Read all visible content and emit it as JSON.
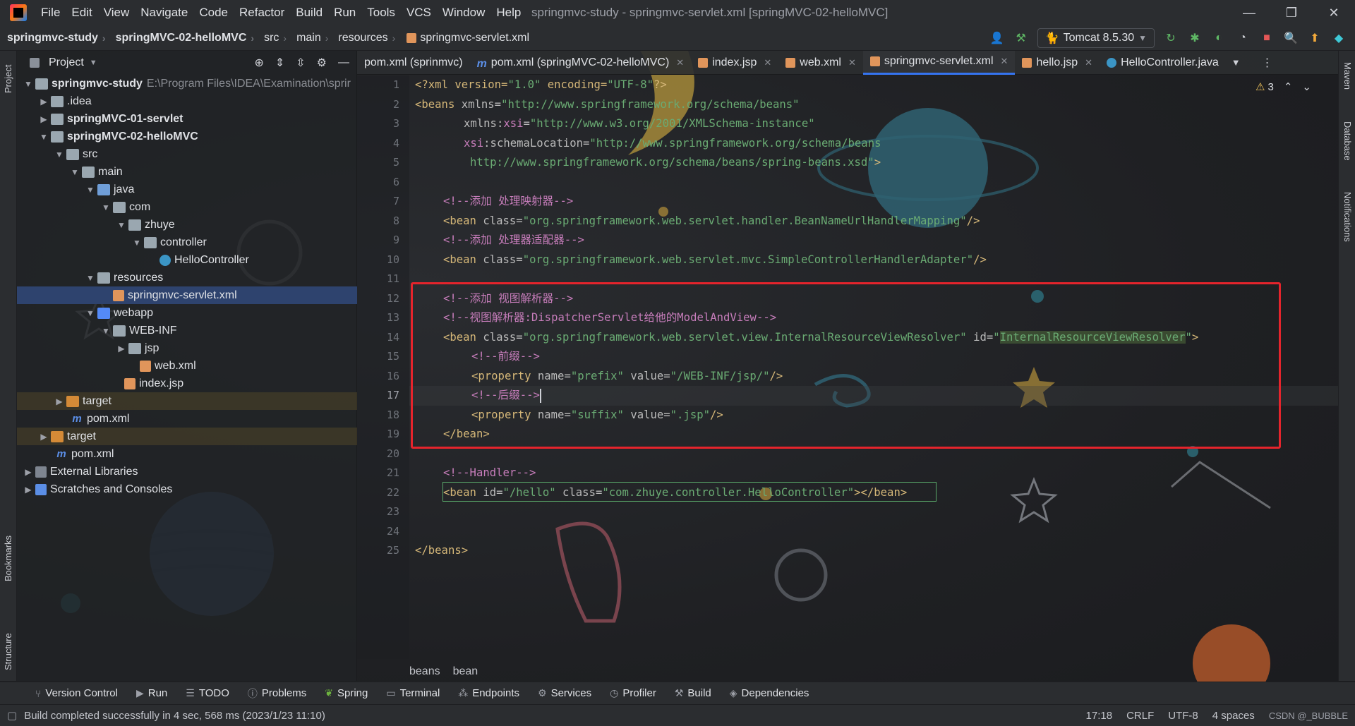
{
  "menubar": {
    "items": [
      "File",
      "Edit",
      "View",
      "Navigate",
      "Code",
      "Refactor",
      "Build",
      "Run",
      "Tools",
      "VCS",
      "Window",
      "Help"
    ],
    "title": "springmvc-study - springmvc-servlet.xml [springMVC-02-helloMVC]",
    "minimize": "—",
    "maximize": "❐",
    "close": "✕"
  },
  "navbar": {
    "crumbs": [
      "springmvc-study",
      "springMVC-02-helloMVC",
      "src",
      "main",
      "resources",
      "springmvc-servlet.xml"
    ],
    "run_config": "Tomcat 8.5.30"
  },
  "left_strip": {
    "project": "Project",
    "bookmarks": "Bookmarks",
    "structure": "Structure"
  },
  "right_strip": {
    "maven": "Maven",
    "database": "Database",
    "notifications": "Notifications"
  },
  "project_panel": {
    "title": "Project",
    "tree": [
      {
        "label": "springmvc-study",
        "path": "E:\\Program Files\\IDEA\\Examination\\sprir",
        "bold": true
      },
      {
        "label": ".idea"
      },
      {
        "label": "springMVC-01-servlet",
        "bold": true
      },
      {
        "label": "springMVC-02-helloMVC",
        "bold": true
      },
      {
        "label": "src"
      },
      {
        "label": "main"
      },
      {
        "label": "java"
      },
      {
        "label": "com"
      },
      {
        "label": "zhuye"
      },
      {
        "label": "controller"
      },
      {
        "label": "HelloController"
      },
      {
        "label": "resources"
      },
      {
        "label": "springmvc-servlet.xml"
      },
      {
        "label": "webapp"
      },
      {
        "label": "WEB-INF"
      },
      {
        "label": "jsp"
      },
      {
        "label": "web.xml"
      },
      {
        "label": "index.jsp"
      },
      {
        "label": "target"
      },
      {
        "label": "pom.xml"
      },
      {
        "label": "target"
      },
      {
        "label": "pom.xml"
      },
      {
        "label": "External Libraries"
      },
      {
        "label": "Scratches and Consoles"
      }
    ]
  },
  "tabs": [
    {
      "label": "pom.xml (sprinmvc)"
    },
    {
      "label": "pom.xml (springMVC-02-helloMVC)"
    },
    {
      "label": "index.jsp"
    },
    {
      "label": "web.xml"
    },
    {
      "label": "springmvc-servlet.xml"
    },
    {
      "label": "hello.jsp"
    },
    {
      "label": "HelloController.java"
    }
  ],
  "editor": {
    "warnings": "3",
    "line_numbers": [
      "1",
      "2",
      "3",
      "4",
      "5",
      "6",
      "7",
      "8",
      "9",
      "10",
      "11",
      "12",
      "13",
      "14",
      "15",
      "16",
      "17",
      "18",
      "19",
      "20",
      "21",
      "22",
      "23",
      "24",
      "25"
    ],
    "code": {
      "l1": [
        "<?xml version=",
        "\"1.0\"",
        " encoding=",
        "\"UTF-8\"",
        "?>"
      ],
      "l2": [
        "<beans ",
        "xmlns=",
        "\"http://www.springframework.org/schema/beans\""
      ],
      "l3": [
        "xmlns:",
        "xsi",
        "=",
        "\"http://www.w3.org/2001/XMLSchema-instance\""
      ],
      "l4": [
        "xsi",
        ":schemaLocation=",
        "\"http://www.springframework.org/schema/beans"
      ],
      "l5": [
        "http://www.springframework.org/schema/beans/spring-beans.xsd\"",
        ">"
      ],
      "l7": "<!--添加 处理映射器-->",
      "l8": [
        "<bean ",
        "class=",
        "\"org.springframework.web.servlet.handler.BeanNameUrlHandlerMapping\"",
        "/>"
      ],
      "l9": "<!--添加 处理器适配器-->",
      "l10": [
        "<bean ",
        "class=",
        "\"org.springframework.web.servlet.mvc.SimpleControllerHandlerAdapter\"",
        "/>"
      ],
      "l12": "<!--添加 视图解析器-->",
      "l13": "<!--视图解析器:DispatcherServlet给他的ModelAndView-->",
      "l14": [
        "<bean ",
        "class=",
        "\"org.springframework.web.servlet.view.InternalResourceViewResolver\"",
        " id=",
        "\"",
        "InternalResourceViewResolver",
        "\"",
        ">"
      ],
      "l15": "<!--前缀-->",
      "l16": [
        "<property ",
        "name=",
        "\"prefix\"",
        " value=",
        "\"/WEB-INF/jsp/\"",
        "/>"
      ],
      "l17": "<!--后缀-->",
      "l18": [
        "<property ",
        "name=",
        "\"suffix\"",
        " value=",
        "\".jsp\"",
        "/>"
      ],
      "l19": "</bean>",
      "l21": "<!--Handler-->",
      "l22": [
        "<bean ",
        "id=",
        "\"/hello\"",
        " class=",
        "\"com.zhuye.controller.HelloController\"",
        "></bean>"
      ],
      "l25": "</beans>"
    },
    "crumbs": [
      "beans",
      "bean"
    ]
  },
  "toolwindows": [
    "Version Control",
    "Run",
    "TODO",
    "Problems",
    "Spring",
    "Terminal",
    "Endpoints",
    "Services",
    "Profiler",
    "Build",
    "Dependencies"
  ],
  "statusbar": {
    "message": "Build completed successfully in 4 sec, 568 ms (2023/1/23 11:10)",
    "position": "17:18",
    "line_sep": "CRLF",
    "encoding": "UTF-8",
    "indent": "4 spaces",
    "watermark": "CSDN @_BUBBLE"
  },
  "colors": {
    "accent": "#3574f0",
    "highlight_box": "#e5242c",
    "tag": "#d5b778",
    "string": "#6aab73",
    "comment": "#c77dbb"
  }
}
